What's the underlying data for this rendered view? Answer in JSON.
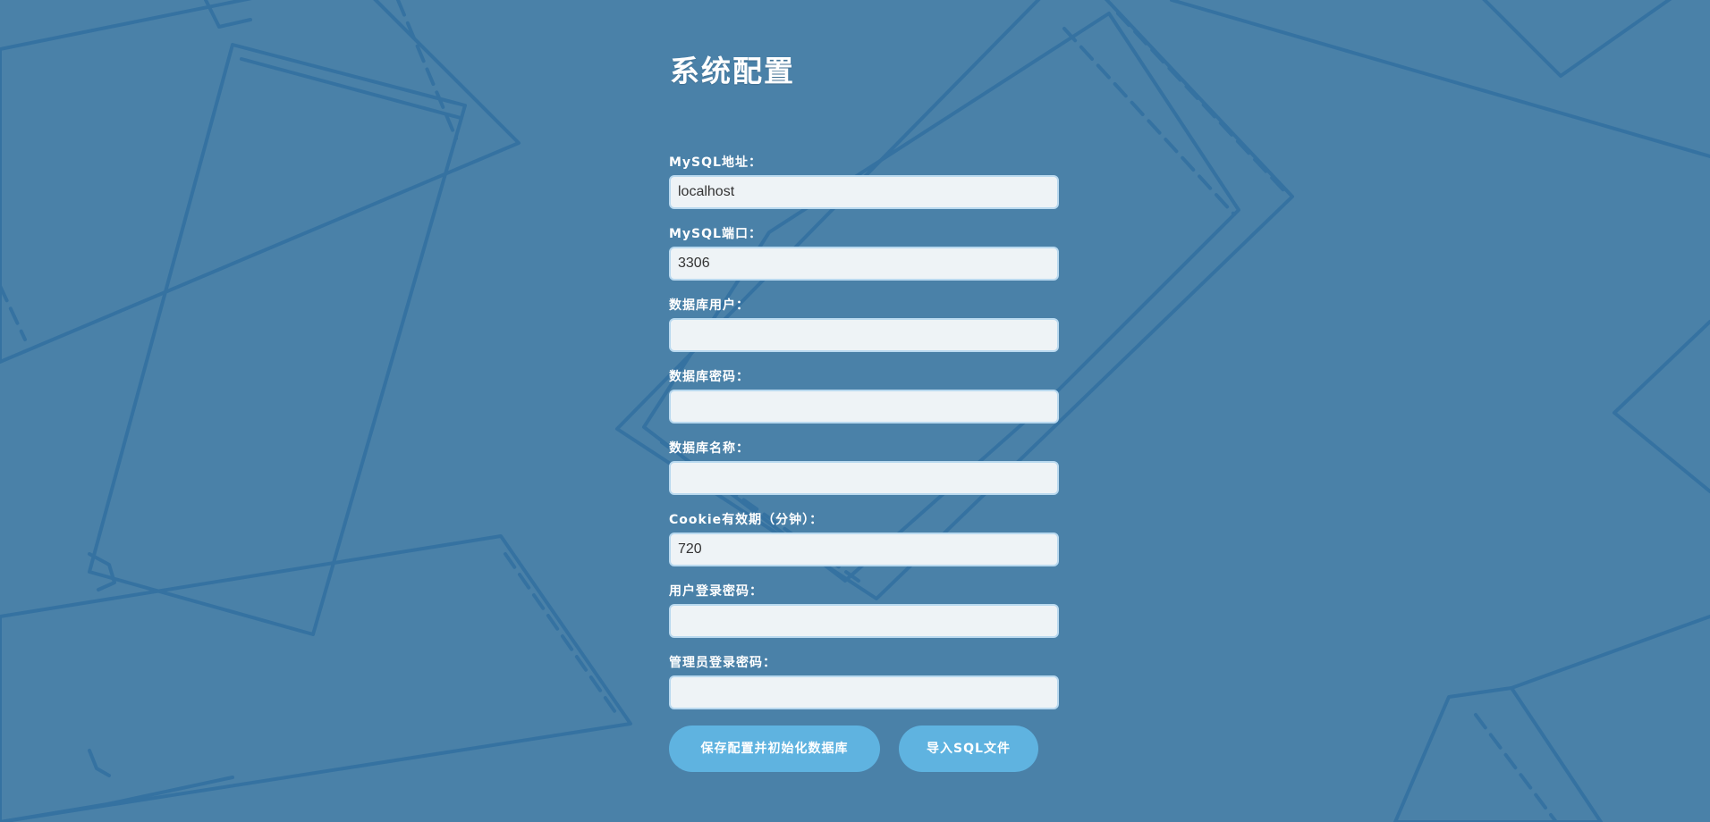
{
  "page": {
    "title": "系统配置"
  },
  "colors": {
    "background": "#4a81a8",
    "background_lines": "#2f6d9f",
    "input_background": "#eef3f6",
    "input_border": "#b9d9ef",
    "button": "#5fb3e0",
    "text": "#ffffff"
  },
  "form": {
    "fields": [
      {
        "label": "MySQL地址：",
        "value": "localhost",
        "placeholder": ""
      },
      {
        "label": "MySQL端口：",
        "value": "3306",
        "placeholder": ""
      },
      {
        "label": "数据库用户：",
        "value": "",
        "placeholder": ""
      },
      {
        "label": "数据库密码：",
        "value": "",
        "placeholder": ""
      },
      {
        "label": "数据库名称：",
        "value": "",
        "placeholder": ""
      },
      {
        "label": "Cookie有效期（分钟）：",
        "value": "720",
        "placeholder": ""
      },
      {
        "label": "用户登录密码：",
        "value": "",
        "placeholder": ""
      },
      {
        "label": "管理员登录密码：",
        "value": "",
        "placeholder": ""
      }
    ]
  },
  "buttons": {
    "save_label": "保存配置并初始化数据库",
    "import_label": "导入SQL文件"
  }
}
